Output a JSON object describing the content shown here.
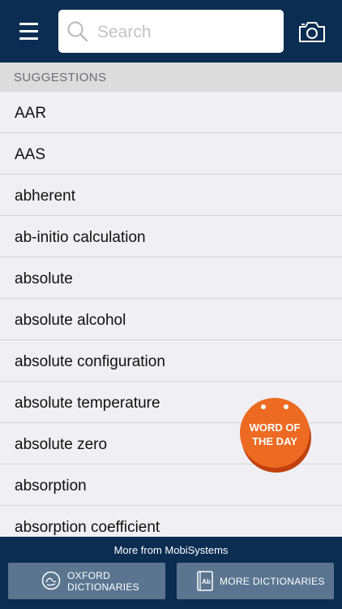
{
  "search": {
    "placeholder": "Search"
  },
  "suggestions": {
    "header": "SUGGESTIONS",
    "items": [
      "AAR",
      "AAS",
      "abherent",
      "ab-initio calculation",
      "absolute",
      "absolute alcohol",
      "absolute configuration",
      "absolute temperature",
      "absolute zero",
      "absorption",
      "absorption coefficient"
    ]
  },
  "word_of_day": {
    "line1": "WORD OF",
    "line2": "THE DAY"
  },
  "footer": {
    "more_from": "More from MobiSystems",
    "oxford_line1": "OXFORD",
    "oxford_line2": "DICTIONARIES",
    "more_dictionaries": "MORE DICTIONARIES"
  },
  "colors": {
    "navy": "#0c2d52",
    "accent_orange": "#ec6a22",
    "button_slate": "#5b7590"
  },
  "icons": {
    "menu": "hamburger-menu-icon",
    "search": "magnifier-icon",
    "camera": "camera-icon",
    "oxford": "globe-icon",
    "dictionary": "book-ab-icon"
  }
}
